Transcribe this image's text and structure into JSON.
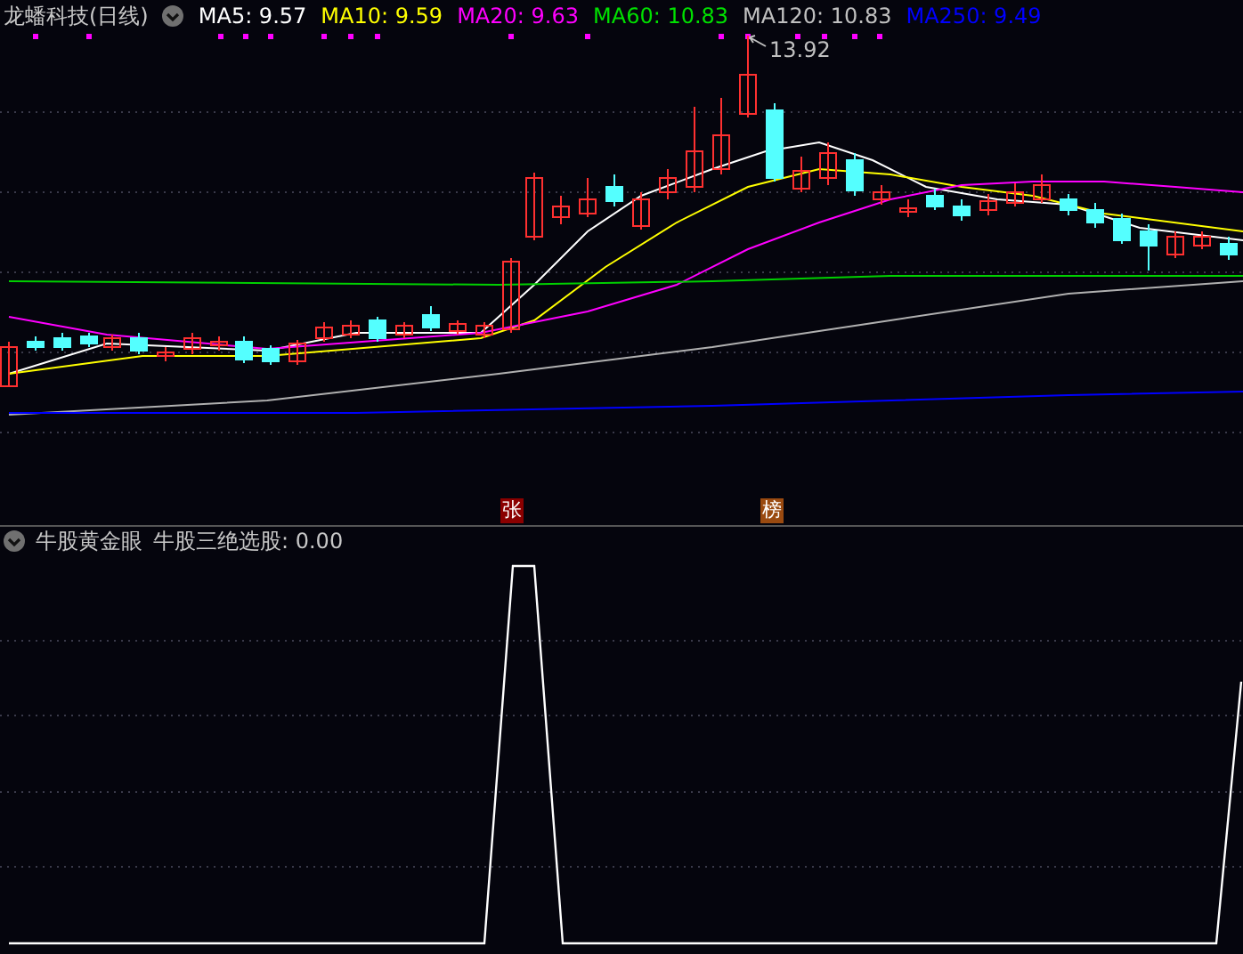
{
  "header": {
    "title": "龙蟠科技(日线)",
    "indicators": [
      {
        "label": "MA5: 9.57",
        "color": "#ffffff"
      },
      {
        "label": "MA10: 9.59",
        "color": "#ffff00"
      },
      {
        "label": "MA20: 9.63",
        "color": "#ff00ff"
      },
      {
        "label": "MA60: 10.83",
        "color": "#00e000"
      },
      {
        "label": "MA120: 10.83",
        "color": "#c0c0c0"
      },
      {
        "label": "MA250: 9.49",
        "color": "#0000ff"
      }
    ]
  },
  "price_chart": {
    "high_label": "13.92",
    "markers": [
      {
        "text": "张",
        "color": "#8b0000"
      },
      {
        "text": "榜",
        "color": "#9a4a10"
      }
    ]
  },
  "lower_panel": {
    "title": "牛股黄金眼",
    "reading": "牛股三绝选股: 0.00"
  }
}
